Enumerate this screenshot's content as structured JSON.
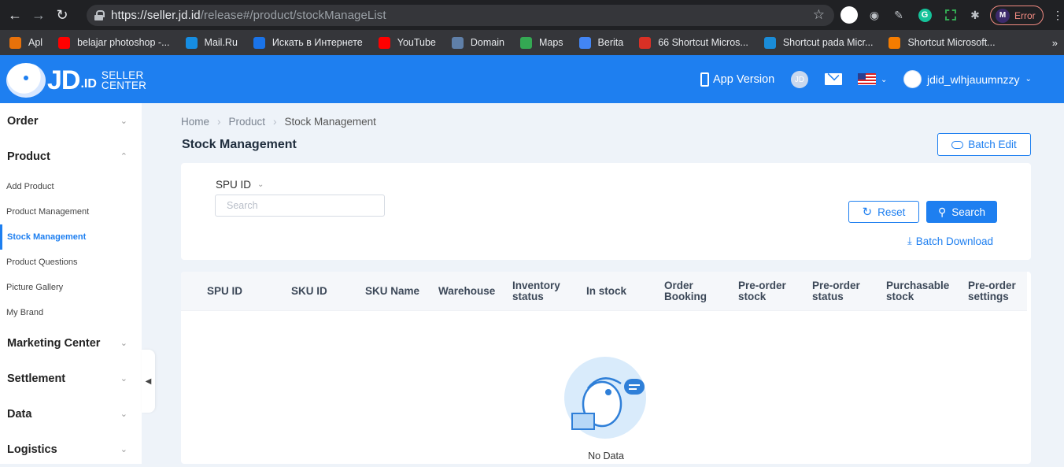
{
  "browser": {
    "url_host": "https://seller.jd.id",
    "url_path": "/release#/product/stockManageList",
    "profile_status": "Error",
    "bookmarks": [
      {
        "label": "Apl",
        "color": "#e8710a"
      },
      {
        "label": "belajar photoshop -...",
        "color": "#ff0000"
      },
      {
        "label": "Mail.Ru",
        "color": "#168de2"
      },
      {
        "label": "Искать в Интернете",
        "color": "#1a73e8"
      },
      {
        "label": "YouTube",
        "color": "#ff0000"
      },
      {
        "label": "Domain",
        "color": "#5f7fa8"
      },
      {
        "label": "Maps",
        "color": "#34a853"
      },
      {
        "label": "Berita",
        "color": "#4285f4"
      },
      {
        "label": "66 Shortcut Micros...",
        "color": "#d93025"
      },
      {
        "label": "Shortcut pada Micr...",
        "color": "#1a8cd8"
      },
      {
        "label": "Shortcut Microsoft...",
        "color": "#f57c00"
      }
    ]
  },
  "header": {
    "logo_jd": "JD",
    "logo_id": ".ID",
    "logo_seller": "SELLER",
    "logo_center": "CENTER",
    "app_version": "App Version",
    "jd_badge": "JD",
    "username": "jdid_wlhjauumnzzy",
    "brand_color": "#1e7ff0"
  },
  "sidebar": {
    "groups": [
      {
        "label": "Order"
      },
      {
        "label": "Product",
        "expanded": true
      },
      {
        "label": "Marketing Center"
      },
      {
        "label": "Settlement"
      },
      {
        "label": "Data"
      },
      {
        "label": "Logistics"
      }
    ],
    "product_items": [
      {
        "label": "Add Product"
      },
      {
        "label": "Product Management"
      },
      {
        "label": "Stock Management",
        "active": true
      },
      {
        "label": "Product Questions"
      },
      {
        "label": "Picture Gallery"
      },
      {
        "label": "My Brand"
      }
    ]
  },
  "breadcrumb": [
    "Home",
    "Product",
    "Stock Management"
  ],
  "page_title": "Stock Management",
  "batch_edit_label": "Batch Edit",
  "filter": {
    "field_label": "SPU ID",
    "placeholder": "Search",
    "value": "",
    "reset_label": "Reset",
    "search_label": "Search",
    "batch_download_label": "Batch Download"
  },
  "table": {
    "columns": [
      "SPU ID",
      "SKU ID",
      "SKU Name",
      "Warehouse",
      "Inventory status",
      "In stock",
      "Order Booking",
      "Pre-order stock",
      "Pre-order status",
      "Purchasable stock",
      "Pre-order settings"
    ],
    "rows": [],
    "empty_text": "No Data"
  }
}
